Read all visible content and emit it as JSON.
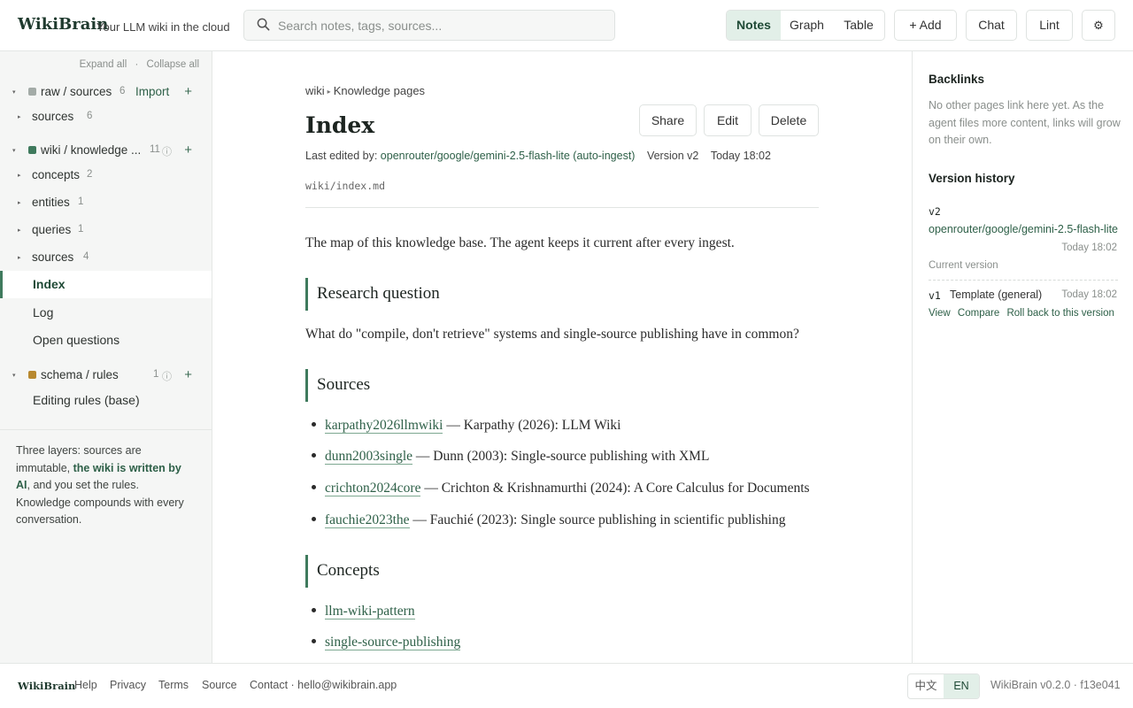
{
  "header": {
    "logo": "WikiBrain",
    "tagline": "Your LLM wiki in the cloud",
    "search_placeholder": "Search notes, tags, sources...",
    "views": [
      "Notes",
      "Graph",
      "Table"
    ],
    "active_view": "Notes",
    "add_label": "+ Add",
    "chat_label": "Chat",
    "lint_label": "Lint",
    "settings_icon": "⚙"
  },
  "sidebar": {
    "expand_all": "Expand all",
    "dot": "·",
    "collapse_all": "Collapse all",
    "raw": {
      "label": "raw / sources",
      "count": "6",
      "import": "Import",
      "color": "#a3aba7"
    },
    "raw_children": [
      {
        "label": "sources",
        "count": "6"
      }
    ],
    "wiki": {
      "label": "wiki / knowledge ...",
      "count": "11",
      "color": "#3f7a5d"
    },
    "wiki_children": [
      {
        "label": "concepts",
        "count": "2"
      },
      {
        "label": "entities",
        "count": "1"
      },
      {
        "label": "queries",
        "count": "1"
      },
      {
        "label": "sources",
        "count": "4"
      }
    ],
    "wiki_pages": [
      "Index",
      "Log",
      "Open questions"
    ],
    "active_page": "Index",
    "schema": {
      "label": "schema / rules",
      "count": "1",
      "color": "#b8892f"
    },
    "schema_pages": [
      "Editing rules (base)"
    ],
    "note_pre": "Three layers: sources are immutable, ",
    "note_bold": "the wiki is written by AI",
    "note_post": ", and you set the rules. Knowledge compounds with every conversation."
  },
  "doc": {
    "crumb_root": "wiki",
    "crumb_leaf": "Knowledge pages",
    "title": "Index",
    "actions": {
      "share": "Share",
      "edit": "Edit",
      "delete": "Delete"
    },
    "meta_prefix": "Last edited by:",
    "meta_model": "openrouter/google/gemini-2.5-flash-lite (auto-ingest)",
    "meta_version": "Version v2",
    "meta_time": "Today 18:02",
    "path": "wiki/index.md",
    "intro": "The map of this knowledge base. The agent keeps it current after every ingest.",
    "h_research": "Research question",
    "research": "What do \"compile, don't retrieve\" systems and single-source publishing have in common?",
    "h_sources": "Sources",
    "sources": [
      {
        "key": "karpathy2026llmwiki",
        "text": "— Karpathy (2026): LLM Wiki"
      },
      {
        "key": "dunn2003single",
        "text": "— Dunn (2003): Single-source publishing with XML"
      },
      {
        "key": "crichton2024core",
        "text": "— Crichton & Krishnamurthi (2024): A Core Calculus for Documents"
      },
      {
        "key": "fauchie2023the",
        "text": "— Fauchié (2023): Single source publishing in scientific publishing"
      }
    ],
    "h_concepts": "Concepts",
    "concepts": [
      "llm-wiki-pattern",
      "single-source-publishing"
    ]
  },
  "right": {
    "backlinks_title": "Backlinks",
    "backlinks_empty": "No other pages link here yet. As the agent files more content, links will grow on their own.",
    "history_title": "Version history",
    "v2": {
      "tag": "v2",
      "author": "openrouter/google/gemini-2.5-flash-lite",
      "time": "Today 18:02",
      "note": "Current version"
    },
    "v1": {
      "tag": "v1",
      "label": "Template (general)",
      "time": "Today 18:02"
    },
    "v1_actions": {
      "view": "View",
      "compare": "Compare",
      "rollback": "Roll back to this version"
    }
  },
  "footer": {
    "logo": "WikiBrain",
    "links": [
      "Help",
      "Privacy",
      "Terms",
      "Source"
    ],
    "contact": "Contact · hello@wikibrain.app",
    "langs": [
      "中文",
      "EN"
    ],
    "active_lang": "EN",
    "version": "WikiBrain v0.2.0 · f13e041"
  },
  "colors": {
    "accent": "#3f7a5d",
    "accent_bg": "#e2efe8",
    "link": "#2e6048"
  }
}
